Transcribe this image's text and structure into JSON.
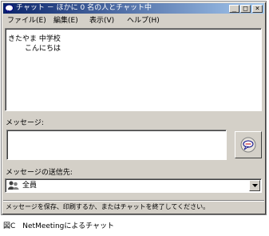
{
  "window": {
    "title": "チャット － ほかに 0 名の人とチャット中",
    "controls": {
      "minimize": "_",
      "maximize": "□",
      "close": "×"
    }
  },
  "menu": [
    "ファイル(E)",
    "編集(E)",
    "表示(V)",
    "ヘルプ(H)"
  ],
  "chat_log": {
    "sender": "きたやま 中学校",
    "message": "こんにちは"
  },
  "message_label": "メッセージ:",
  "message_input": {
    "value": ""
  },
  "recipient": {
    "label": "メッセージの送信先:",
    "selected": "全員"
  },
  "status_bar": "メッセージを保存、印刷するか、またはチャットを終了してください。",
  "caption": "図C　NetMeetingによるチャット",
  "icons": {
    "app": "chat-app-icon",
    "send": "send-message-icon",
    "recipient": "group-people-icon",
    "dropdown": "chevron-down-icon"
  },
  "colors": {
    "titlebar_start": "#0a246a",
    "titlebar_end": "#a6caf0",
    "window_face": "#d4d0c8"
  }
}
